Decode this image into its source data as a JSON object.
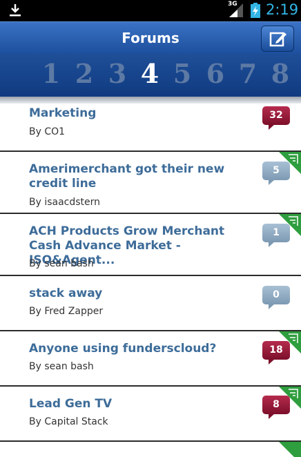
{
  "status_bar": {
    "network": "3G",
    "time": "2:19",
    "icons": [
      "download-icon",
      "signal-icon",
      "battery-charging-icon"
    ]
  },
  "header": {
    "title": "Forums",
    "compose_icon": "compose-icon"
  },
  "pages": {
    "items": [
      "1",
      "2",
      "3",
      "4",
      "5",
      "6",
      "7",
      "8"
    ],
    "current": "4"
  },
  "colors": {
    "header_blue": "#1c4f9c",
    "title_blue": "#3d6c99",
    "badge_red": "#7c0f2a",
    "badge_gray": "#7d9ab3",
    "new_corner_green": "#2e9e3e"
  },
  "threads": [
    {
      "title": "Marketing",
      "author": "By CO1",
      "replies": "32",
      "badge": "red",
      "new": false
    },
    {
      "title": "Amerimerchant got their new credit line",
      "author": "By isaacdstern",
      "replies": "5",
      "badge": "gray",
      "new": true
    },
    {
      "title": "ACH Products Grow Merchant Cash Advance Market - ISO&Agent...",
      "author": "By sean bash",
      "replies": "1",
      "badge": "gray",
      "new": true
    },
    {
      "title": "stack away",
      "author": "By Fred Zapper",
      "replies": "0",
      "badge": "gray",
      "new": false
    },
    {
      "title": "Anyone using funderscloud?",
      "author": "By sean bash",
      "replies": "18",
      "badge": "red",
      "new": true
    },
    {
      "title": "Lead Gen TV",
      "author": "By Capital Stack",
      "replies": "8",
      "badge": "red",
      "new": true
    }
  ]
}
